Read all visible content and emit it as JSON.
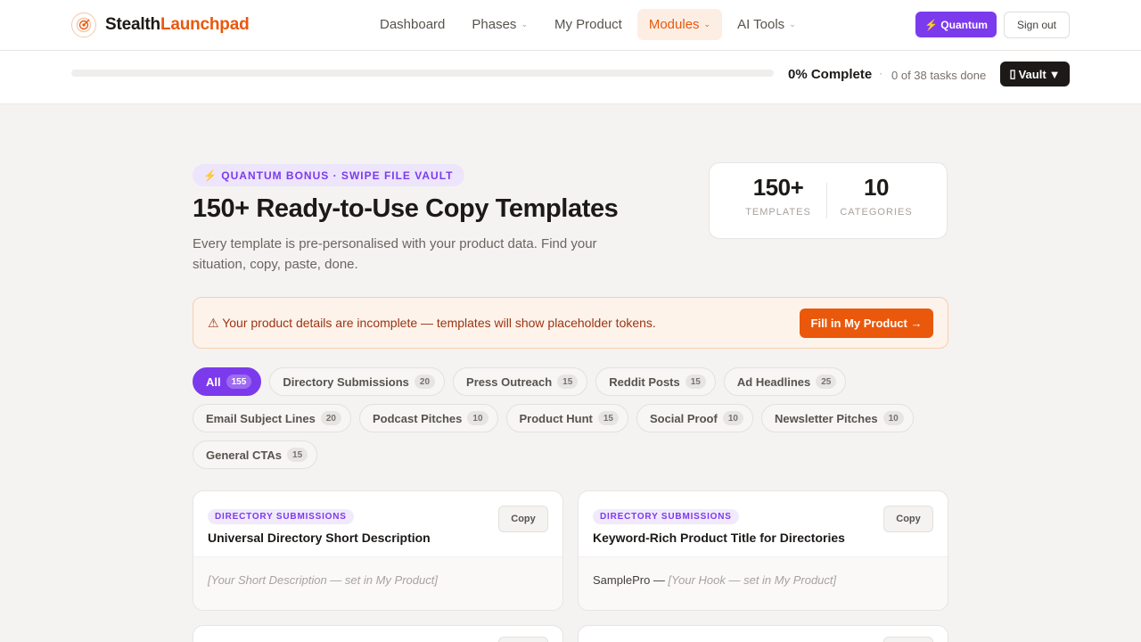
{
  "brand": {
    "name_part1": "Stealth",
    "name_part2": "Launchpad",
    "logo_icon": "target-icon"
  },
  "nav": {
    "items": [
      {
        "label": "Dashboard",
        "has_dropdown": false,
        "active": false
      },
      {
        "label": "Phases",
        "has_dropdown": true,
        "active": false
      },
      {
        "label": "My Product",
        "has_dropdown": false,
        "active": false
      },
      {
        "label": "Modules",
        "has_dropdown": true,
        "active": true
      },
      {
        "label": "AI Tools",
        "has_dropdown": true,
        "active": false
      }
    ],
    "quantum_label": "⚡ Quantum",
    "signout_label": "Sign out"
  },
  "progress": {
    "percent_label": "0% Complete",
    "percent_value": 0,
    "separator": "·",
    "tasks_label": "0 of 38 tasks done",
    "vault_label": "▼",
    "vault_text": "Vault",
    "vault_icon": "vault-icon"
  },
  "hero": {
    "badge": "⚡ QUANTUM BONUS · SWIPE FILE VAULT",
    "title": "150+ Ready-to-Use Copy Templates",
    "subtitle": "Every template is pre-personalised with your product data. Find your situation, copy, paste, done."
  },
  "stats": [
    {
      "value": "150+",
      "label": "TEMPLATES"
    },
    {
      "value": "10",
      "label": "CATEGORIES"
    }
  ],
  "warning": {
    "text": "⚠ Your product details are incomplete — templates will show placeholder tokens.",
    "button": "Fill in My Product →"
  },
  "filters": [
    {
      "label": "All",
      "count": "155",
      "active": true
    },
    {
      "label": "Directory Submissions",
      "count": "20",
      "active": false
    },
    {
      "label": "Press Outreach",
      "count": "15",
      "active": false
    },
    {
      "label": "Reddit Posts",
      "count": "15",
      "active": false
    },
    {
      "label": "Ad Headlines",
      "count": "25",
      "active": false
    },
    {
      "label": "Email Subject Lines",
      "count": "20",
      "active": false
    },
    {
      "label": "Podcast Pitches",
      "count": "10",
      "active": false
    },
    {
      "label": "Product Hunt",
      "count": "15",
      "active": false
    },
    {
      "label": "Social Proof",
      "count": "10",
      "active": false
    },
    {
      "label": "Newsletter Pitches",
      "count": "10",
      "active": false
    },
    {
      "label": "General CTAs",
      "count": "15",
      "active": false
    }
  ],
  "templates": [
    {
      "category": "DIRECTORY SUBMISSIONS",
      "title": "Universal Directory Short Description",
      "copy_label": "Copy",
      "body_prefix": "",
      "body_placeholder": "[Your Short Description — set in My Product]"
    },
    {
      "category": "DIRECTORY SUBMISSIONS",
      "title": "Keyword-Rich Product Title for Directories",
      "copy_label": "Copy",
      "body_prefix": "SamplePro — ",
      "body_placeholder": "[Your Hook — set in My Product]"
    }
  ],
  "colors": {
    "accent": "#ea580c",
    "quantum": "#7c3aed",
    "background": "#f4f3f1"
  }
}
